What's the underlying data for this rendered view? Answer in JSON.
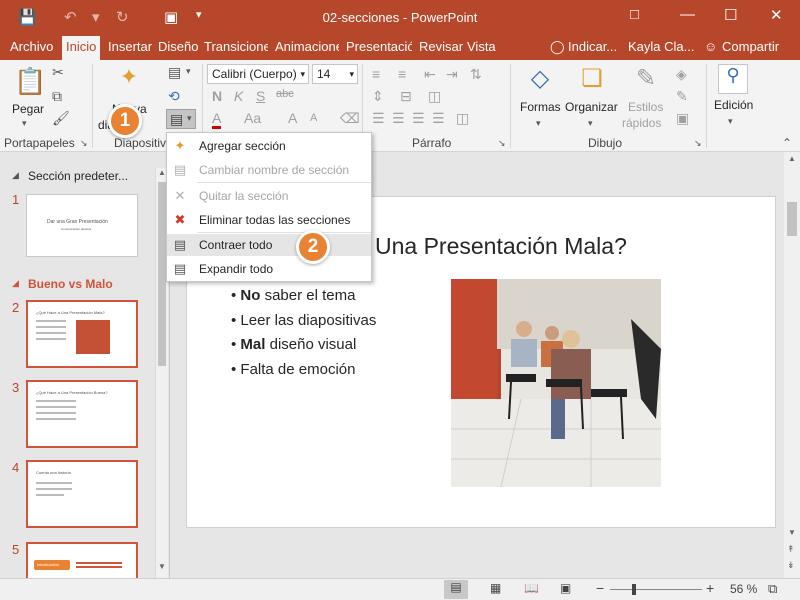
{
  "colors": {
    "brand": "#b7472a",
    "callout": "#e98233",
    "section_accent": "#d0533a"
  },
  "titlebar": {
    "title": "02-secciones  -  PowerPoint",
    "icons": [
      "save-icon",
      "undo-icon",
      "redo-icon",
      "start-from-beginning-icon",
      "customize-qat-icon",
      "ribbon-display-icon",
      "minimize-icon",
      "maximize-icon",
      "close-icon"
    ]
  },
  "tabs": [
    "Archivo",
    "Inicio",
    "Insertar",
    "Diseño",
    "Transiciones",
    "Animaciones",
    "Presentación",
    "Revisar",
    "Vista"
  ],
  "active_tab": "Inicio",
  "tell_me": "Indicar...",
  "user": "Kayla Cla...",
  "share": "Compartir",
  "ribbon": {
    "paste": "Pegar",
    "new_slide_line1": "Nueva",
    "new_slide_line2": "dia",
    "font_name": "Calibri (Cuerpo)",
    "font_size": "14",
    "bold": "N",
    "italic": "K",
    "underline": "S",
    "strike": "abc",
    "font_color": "A",
    "char_spacing": "Aa",
    "grow": "A",
    "shrink": "A",
    "shapes": "Formas",
    "arrange": "Organizar",
    "quick_styles_1": "Estilos",
    "quick_styles_2": "rápidos",
    "editing": "Edición",
    "groups": {
      "clipboard": "Portapapeles",
      "slides": "Diapositiv",
      "paragraph": "Párrafo",
      "drawing": "Dibujo"
    }
  },
  "menu": {
    "items": [
      {
        "label": "Agregar sección",
        "enabled": true,
        "icon": "add-section-icon"
      },
      {
        "label": "Cambiar nombre de sección",
        "enabled": false,
        "icon": "rename-section-icon"
      },
      {
        "label": "Quitar la sección",
        "enabled": false,
        "icon": "remove-section-icon"
      },
      {
        "label": "Eliminar todas las secciones",
        "enabled": true,
        "icon": "remove-all-sections-icon"
      },
      {
        "label": "Contraer todo",
        "enabled": true,
        "icon": "collapse-all-icon"
      },
      {
        "label": "Expandir todo",
        "enabled": true,
        "icon": "expand-all-icon"
      }
    ]
  },
  "callouts": [
    "1",
    "2"
  ],
  "sidebar": {
    "section_default": "Sección predeter...",
    "section_bad": "Bueno vs Malo",
    "slides": [
      {
        "num": "1",
        "text": "Dar una Gran Presentación",
        "sub": "Comunicación efectiva"
      },
      {
        "num": "2",
        "text": "¿Qué Hace a Una Presentación Mala?"
      },
      {
        "num": "3",
        "text": "¿Qué Hace a Una Presentación Buena?"
      },
      {
        "num": "4",
        "text": "Cuenta una historia"
      },
      {
        "num": "5",
        "text": "Introducción"
      }
    ]
  },
  "slide": {
    "title": "Una Presentación Mala?",
    "bullets": [
      {
        "bold": "No",
        "rest": " saber el tema"
      },
      {
        "bold": "",
        "rest": "Leer las diapositivas"
      },
      {
        "bold": "Mal",
        "rest": " diseño visual"
      },
      {
        "bold": "",
        "rest": "Falta de emoción"
      }
    ]
  },
  "status": {
    "zoom": "56 %",
    "zoom_level": 0.56,
    "minus": "−",
    "plus": "+"
  }
}
